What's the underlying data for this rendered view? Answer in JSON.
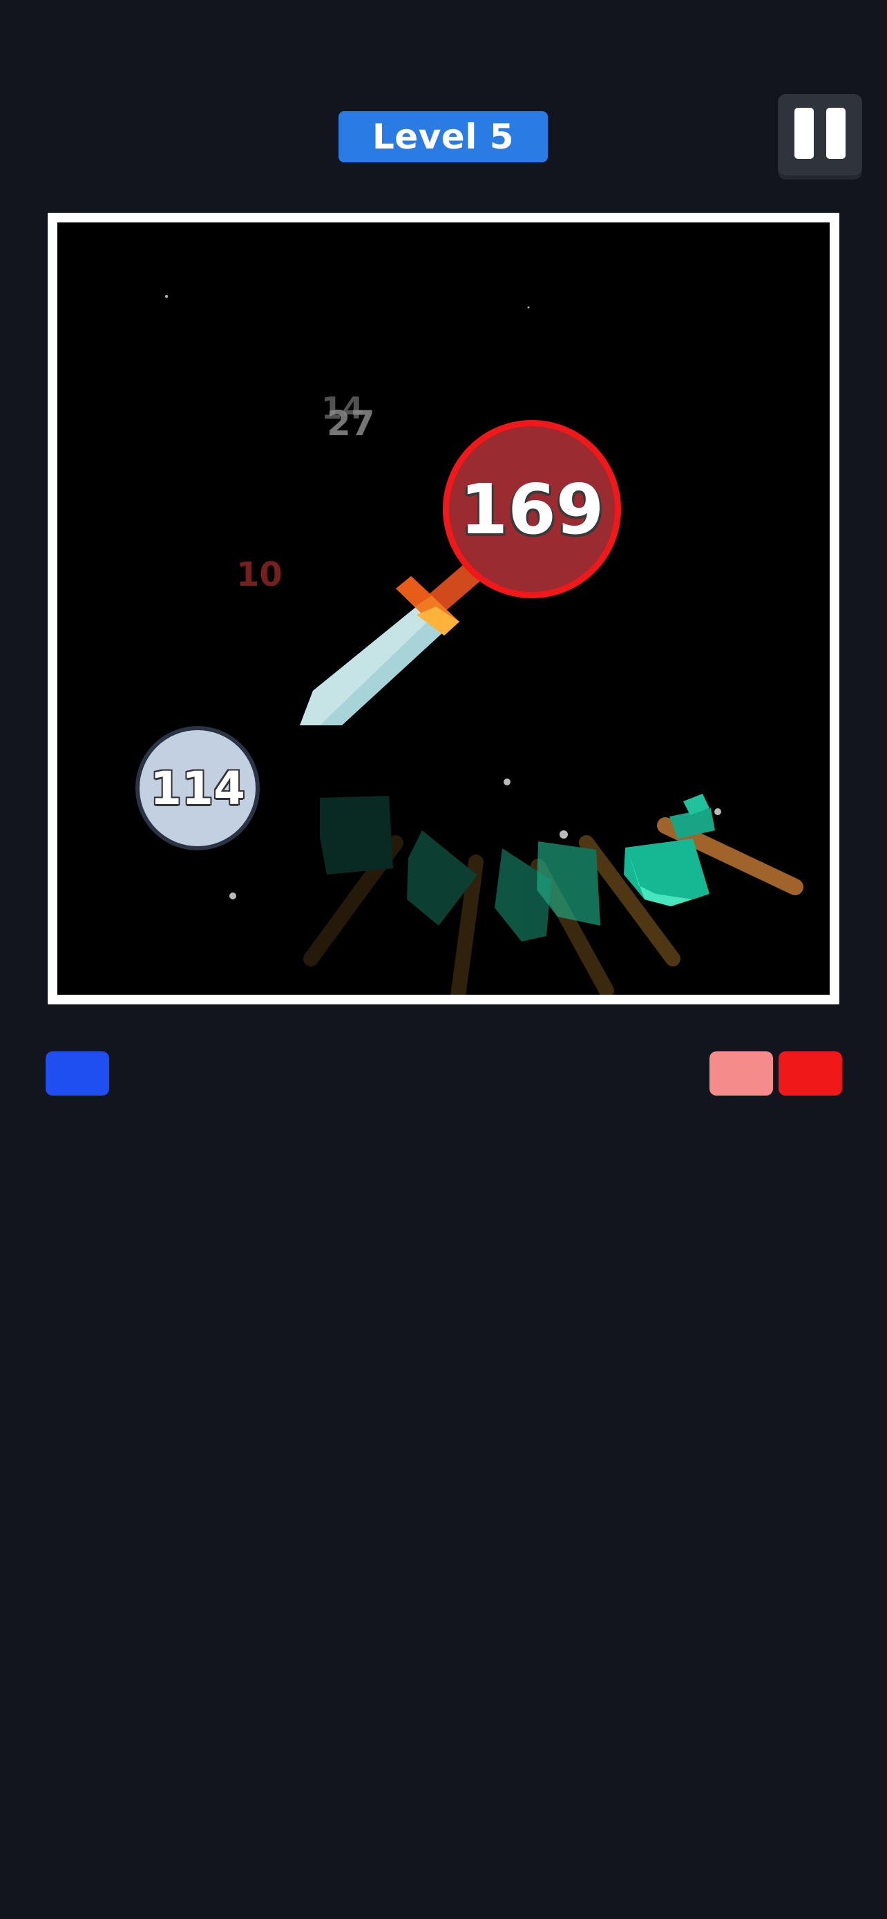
{
  "header": {
    "level_label": "Level 5"
  },
  "arena": {
    "enemy_ball": {
      "value": "169",
      "color": "#9a2b30",
      "ring_color": "#f01818"
    },
    "player_ball": {
      "value": "114",
      "color": "#c3d0e2"
    },
    "damage_popups": [
      "14",
      "27",
      "10"
    ],
    "weapons": [
      "sword",
      "axe"
    ]
  },
  "lives": {
    "player": {
      "count": 1,
      "colors": [
        "#1f4ff0"
      ]
    },
    "enemy": {
      "count": 2,
      "colors": [
        "#f58b8b",
        "#f01818"
      ]
    }
  }
}
